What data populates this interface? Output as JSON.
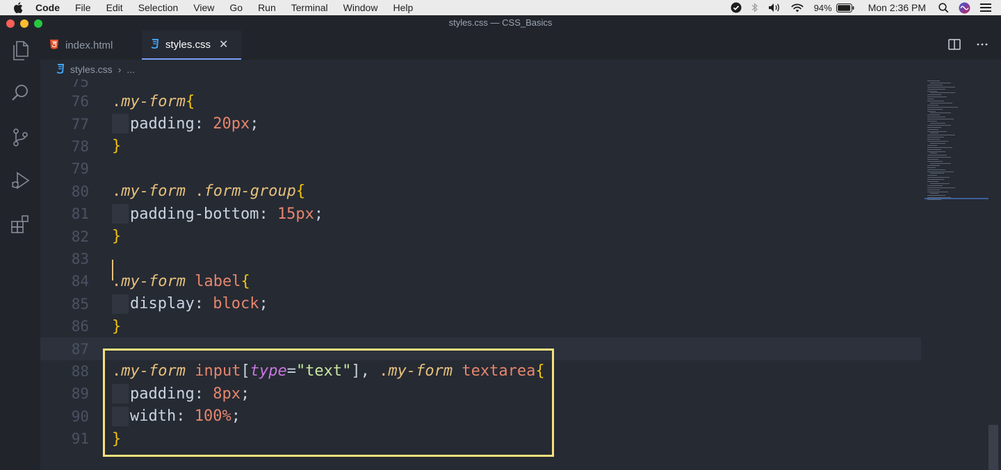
{
  "menubar": {
    "app": "Code",
    "items": [
      "File",
      "Edit",
      "Selection",
      "View",
      "Go",
      "Run",
      "Terminal",
      "Window",
      "Help"
    ],
    "battery": "94%",
    "clock": "Mon 2:36 PM"
  },
  "window": {
    "title": "styles.css — CSS_Basics"
  },
  "tabs": [
    {
      "label": "index.html",
      "icon": "html5-icon",
      "icon_color": "#e44d26",
      "active": false
    },
    {
      "label": "styles.css",
      "icon": "css3-icon",
      "icon_color": "#42a5f5",
      "active": true
    }
  ],
  "breadcrumb": {
    "file": "styles.css",
    "more": "..."
  },
  "editor": {
    "partial_top_line": "75",
    "current_line": "87",
    "lines": [
      {
        "n": "76",
        "tokens": [
          [
            ".",
            "tok-dot"
          ],
          [
            "my-form",
            "tok-class"
          ],
          [
            "{",
            "tok-brace"
          ]
        ]
      },
      {
        "n": "77",
        "indent": true,
        "tokens": [
          [
            "padding",
            "tok-prop"
          ],
          [
            ": ",
            "tok-punct"
          ],
          [
            "20px",
            "tok-num"
          ],
          [
            ";",
            "tok-punct"
          ]
        ]
      },
      {
        "n": "78",
        "tokens": [
          [
            "}",
            "tok-brace"
          ]
        ]
      },
      {
        "n": "79",
        "tokens": []
      },
      {
        "n": "80",
        "tokens": [
          [
            ".",
            "tok-dot"
          ],
          [
            "my-form",
            "tok-class"
          ],
          [
            " ",
            "tok-punct"
          ],
          [
            ".",
            "tok-dot"
          ],
          [
            "form-group",
            "tok-class"
          ],
          [
            "{",
            "tok-brace"
          ]
        ]
      },
      {
        "n": "81",
        "indent": true,
        "tokens": [
          [
            "padding-bottom",
            "tok-prop"
          ],
          [
            ": ",
            "tok-punct"
          ],
          [
            "15px",
            "tok-num"
          ],
          [
            ";",
            "tok-punct"
          ]
        ]
      },
      {
        "n": "82",
        "tokens": [
          [
            "}",
            "tok-brace"
          ]
        ]
      },
      {
        "n": "83",
        "tokens": []
      },
      {
        "n": "84",
        "tokens": [
          [
            ".",
            "tok-dot"
          ],
          [
            "my-form",
            "tok-class"
          ],
          [
            " ",
            "tok-punct"
          ],
          [
            "label",
            "tok-tag"
          ],
          [
            "{",
            "tok-brace"
          ]
        ]
      },
      {
        "n": "85",
        "indent": true,
        "tokens": [
          [
            "display",
            "tok-prop"
          ],
          [
            ": ",
            "tok-punct"
          ],
          [
            "block",
            "tok-num"
          ],
          [
            ";",
            "tok-punct"
          ]
        ]
      },
      {
        "n": "86",
        "tokens": [
          [
            "}",
            "tok-brace"
          ]
        ]
      },
      {
        "n": "87",
        "tokens": []
      },
      {
        "n": "88",
        "tokens": [
          [
            ".",
            "tok-dot"
          ],
          [
            "my-form",
            "tok-class"
          ],
          [
            " ",
            "tok-punct"
          ],
          [
            "input",
            "tok-tag"
          ],
          [
            "[",
            "tok-punct"
          ],
          [
            "type",
            "tok-attr"
          ],
          [
            "=",
            "tok-punct"
          ],
          [
            "\"text\"",
            "tok-str"
          ],
          [
            "], ",
            "tok-punct"
          ],
          [
            ".",
            "tok-dot"
          ],
          [
            "my-form",
            "tok-class"
          ],
          [
            " ",
            "tok-punct"
          ],
          [
            "textarea",
            "tok-tag"
          ],
          [
            "{",
            "tok-brace"
          ]
        ]
      },
      {
        "n": "89",
        "indent": true,
        "tokens": [
          [
            "padding",
            "tok-prop"
          ],
          [
            ": ",
            "tok-punct"
          ],
          [
            "8px",
            "tok-num"
          ],
          [
            ";",
            "tok-punct"
          ]
        ]
      },
      {
        "n": "90",
        "indent": true,
        "tokens": [
          [
            "width",
            "tok-prop"
          ],
          [
            ": ",
            "tok-punct"
          ],
          [
            "100%",
            "tok-num"
          ],
          [
            ";",
            "tok-punct"
          ]
        ]
      },
      {
        "n": "91",
        "tokens": [
          [
            "}",
            "tok-brace"
          ]
        ]
      }
    ]
  },
  "colors": {
    "editor_bg": "#262a33",
    "highlight_box": "#f4e17c",
    "selector": "#e5c07b",
    "number": "#e5866c"
  }
}
